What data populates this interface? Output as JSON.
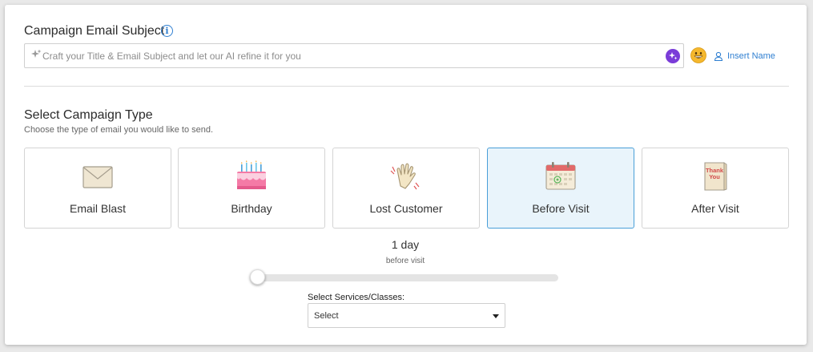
{
  "email_subject": {
    "title": "Campaign Email Subject",
    "info_icon": "info-icon",
    "input_value": "",
    "input_placeholder": "Craft your Title & Email Subject and let our AI refine it for you",
    "ai_icon": "sparkle-icon",
    "emoji_icon": "smiley-emoji-icon",
    "insert_name_label": "Insert Name",
    "insert_name_icon": "user-icon"
  },
  "campaign_type": {
    "title": "Select Campaign Type",
    "subtitle": "Choose the type of email you would like to send.",
    "selected": "Before Visit",
    "types": [
      {
        "label": "Email Blast",
        "icon": "envelope-icon"
      },
      {
        "label": "Birthday",
        "icon": "birthday-cake-icon"
      },
      {
        "label": "Lost Customer",
        "icon": "waving-glove-icon"
      },
      {
        "label": "Before Visit",
        "icon": "calendar-icon"
      },
      {
        "label": "After Visit",
        "icon": "thank-you-card-icon"
      }
    ]
  },
  "timing_slider": {
    "value_text": "1 day",
    "unit_text": "before visit",
    "fraction": 0
  },
  "services_select": {
    "label": "Select Services/Classes:",
    "selected_value": "Select"
  },
  "colors": {
    "accent_blue": "#2f7fd1",
    "ai_purple": "#7a3cd8",
    "selected_bg": "#e9f4fb",
    "selected_border": "#4a9fd8"
  }
}
